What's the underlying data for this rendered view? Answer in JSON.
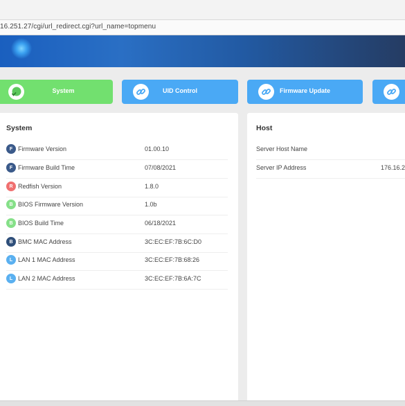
{
  "browser": {
    "url": "16.251.27/cgi/url_redirect.cgi?url_name=topmenu"
  },
  "tiles": [
    {
      "label": "System",
      "icon": "system-check-icon",
      "color": "#72e06f"
    },
    {
      "label": "UID Control",
      "icon": "link-icon",
      "color": "#4aa9f5"
    },
    {
      "label": "Firmware Update",
      "icon": "link-icon",
      "color": "#4aa9f5"
    },
    {
      "label": "",
      "icon": "link-icon",
      "color": "#4aa9f5"
    }
  ],
  "system_panel": {
    "title": "System",
    "rows": [
      {
        "badge": "F",
        "badge_color": "#3b5a8a",
        "label": "Firmware Version",
        "value": "01.00.10"
      },
      {
        "badge": "F",
        "badge_color": "#3b5a8a",
        "label": "Firmware Build Time",
        "value": "07/08/2021"
      },
      {
        "badge": "R",
        "badge_color": "#f07070",
        "label": "Redfish Version",
        "value": "1.8.0"
      },
      {
        "badge": "B",
        "badge_color": "#86e089",
        "label": "BIOS Firmware Version",
        "value": "1.0b"
      },
      {
        "badge": "B",
        "badge_color": "#86e089",
        "label": "BIOS Build Time",
        "value": "06/18/2021"
      },
      {
        "badge": "B",
        "badge_color": "#2f4f7a",
        "label": "BMC MAC Address",
        "value": "3C:EC:EF:7B:6C:D0"
      },
      {
        "badge": "L",
        "badge_color": "#5ab0f0",
        "label": "LAN 1 MAC Address",
        "value": "3C:EC:EF:7B:68:26"
      },
      {
        "badge": "L",
        "badge_color": "#5ab0f0",
        "label": "LAN 2 MAC Address",
        "value": "3C:EC:EF:7B:6A:7C"
      }
    ]
  },
  "host_panel": {
    "title": "Host",
    "rows": [
      {
        "label": "Server Host Name",
        "value": ""
      },
      {
        "label": "Server IP Address",
        "value": "176.16.2"
      }
    ]
  }
}
